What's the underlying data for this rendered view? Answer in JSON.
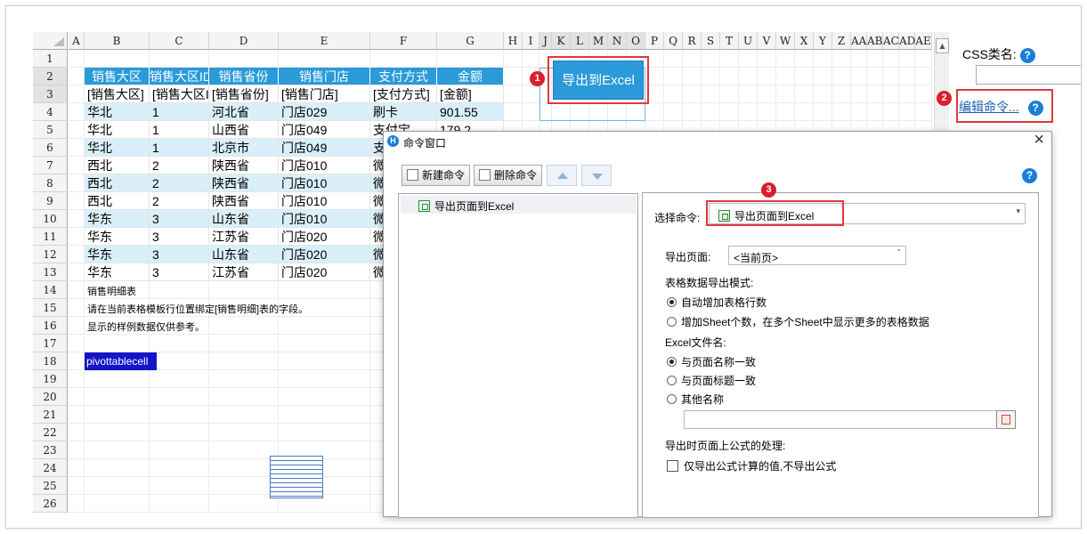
{
  "sheet": {
    "columns": [
      "A",
      "B",
      "C",
      "D",
      "E",
      "F",
      "G",
      "H",
      "I",
      "J",
      "K",
      "L",
      "M",
      "N",
      "O",
      "P",
      "Q",
      "R",
      "S",
      "T",
      "U",
      "V",
      "W",
      "X",
      "Y",
      "Z",
      "AA",
      "AB",
      "AC",
      "AD",
      "AE"
    ],
    "rows": [
      "1",
      "2",
      "3",
      "4",
      "5",
      "6",
      "7",
      "8",
      "9",
      "10",
      "11",
      "12",
      "13",
      "14",
      "15",
      "16",
      "17",
      "18",
      "19",
      "20",
      "21",
      "22",
      "23",
      "24",
      "25",
      "26"
    ],
    "header_row": [
      "销售大区",
      "销售大区ID",
      "销售省份",
      "销售门店",
      "支付方式",
      "金额"
    ],
    "binding_row": [
      "[销售大区]",
      "[销售大区ID]",
      "[销售省份]",
      "[销售门店]",
      "[支付方式]",
      "[金额]"
    ],
    "data_rows": [
      [
        "华北",
        "1",
        "河北省",
        "门店029",
        "刷卡",
        "901.55"
      ],
      [
        "华北",
        "1",
        "山西省",
        "门店049",
        "支付宝",
        "179.2"
      ],
      [
        "华北",
        "1",
        "北京市",
        "门店049",
        "支付宝",
        ""
      ],
      [
        "西北",
        "2",
        "陕西省",
        "门店010",
        "微信",
        ""
      ],
      [
        "西北",
        "2",
        "陕西省",
        "门店010",
        "微信",
        ""
      ],
      [
        "西北",
        "2",
        "陕西省",
        "门店010",
        "微信",
        ""
      ],
      [
        "华东",
        "3",
        "山东省",
        "门店010",
        "微信",
        ""
      ],
      [
        "华东",
        "3",
        "江苏省",
        "门店020",
        "微信",
        ""
      ],
      [
        "华东",
        "3",
        "山东省",
        "门店020",
        "微信",
        ""
      ],
      [
        "华东",
        "3",
        "江苏省",
        "门店020",
        "微信",
        ""
      ]
    ],
    "note_lines": [
      "销售明细表",
      "请在当前表格模板行位置绑定[销售明细]表的字段。",
      "显示的样例数据仅供参考。"
    ],
    "pivot_cell": "pivottablecell"
  },
  "export_button": {
    "label": "导出到Excel"
  },
  "badges": [
    "1",
    "2",
    "3"
  ],
  "right_panel": {
    "css_label": "CSS类名:",
    "edit_command": "编辑命令...",
    "help": "?"
  },
  "dialog": {
    "title": "命令窗口",
    "close": "×",
    "new_command": "新建命令",
    "delete_command": "删除命令",
    "help": "?",
    "command_list": [
      "导出页面到Excel"
    ],
    "select_command_label": "选择命令:",
    "selected_command": "导出页面到Excel",
    "export_page_label": "导出页面:",
    "export_page_value": "<当前页>",
    "mode_label": "表格数据导出模式:",
    "mode_options": [
      "自动增加表格行数",
      "增加Sheet个数，在多个Sheet中显示更多的表格数据"
    ],
    "mode_selected": 0,
    "filename_label": "Excel文件名:",
    "filename_options": [
      "与页面名称一致",
      "与页面标题一致",
      "其他名称"
    ],
    "filename_selected": 0,
    "formula_label": "导出时页面上公式的处理:",
    "formula_checkbox": "仅导出公式计算的值,不导出公式",
    "formula_checked": false
  },
  "colors": {
    "accent": "#2a9ad8",
    "band": "#d9f0fa",
    "badge": "#d9202c",
    "highlight_box": "#e0383e",
    "link": "#1b5fb0"
  }
}
